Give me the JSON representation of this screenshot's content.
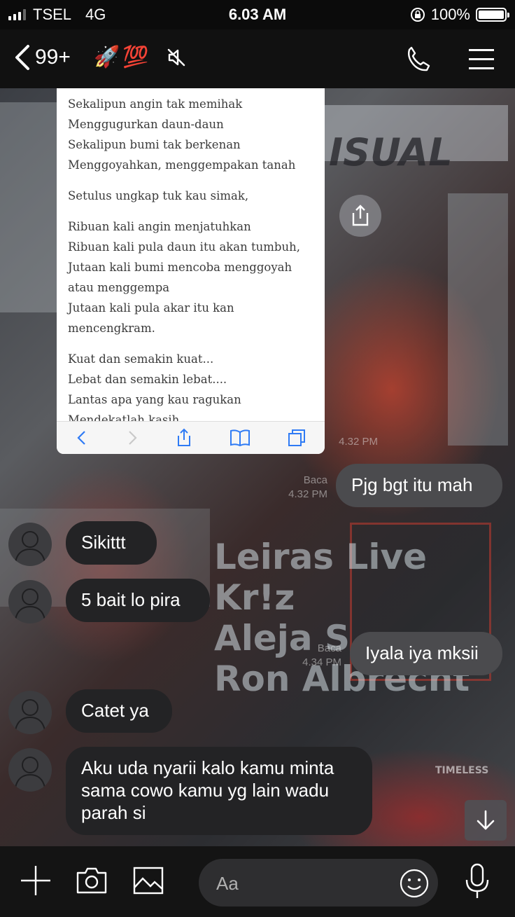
{
  "status": {
    "carrier": "TSEL",
    "network": "4G",
    "time": "6.03 AM",
    "battery": "100%"
  },
  "header": {
    "unread_count": "99+",
    "emojis": "🚀💯"
  },
  "article": {
    "stanza1": [
      "Sekalipun angin tak memihak",
      "Menggugurkan daun-daun",
      "Sekalipun bumi tak berkenan",
      "Menggoyahkan, menggempakan tanah"
    ],
    "stanza2": [
      "Setulus ungkap tuk kau simak,"
    ],
    "stanza3": [
      "Ribuan kali angin menjatuhkan",
      "Ribuan kali pula daun itu akan tumbuh,",
      "Jutaan kali bumi mencoba menggoyah atau menggempa",
      "Jutaan kali pula akar itu kan mencengkram."
    ],
    "stanza4": [
      "Kuat dan semakin kuat...",
      "Lebat dan semakin lebat....",
      "Lantas apa yang kau ragukan",
      "Mendekatlah kasih.."
    ]
  },
  "messages": [
    {
      "side": "out",
      "text": "Pjg bgt itu mah",
      "read": "Baca",
      "time": "4.32 PM"
    },
    {
      "side": "in",
      "text": "Sikittt"
    },
    {
      "side": "in",
      "text": "5 bait lo pira"
    },
    {
      "side": "out",
      "text": "Iyala iya mksii",
      "read": "Baca",
      "time": "4.34 PM"
    },
    {
      "side": "in",
      "text": "Catet ya"
    },
    {
      "side": "in",
      "text": "Aku uda nyarii kalo kamu minta sama cowo kamu yg lain wadu parah si"
    }
  ],
  "earlier_time": "4.32 PM",
  "composer": {
    "placeholder": "Aa"
  },
  "icons": [
    "back-chevron-icon",
    "mute-icon",
    "phone-icon",
    "menu-icon",
    "share-icon",
    "plus-icon",
    "camera-icon",
    "image-icon",
    "emoji-icon",
    "microphone-icon",
    "arrow-down-icon"
  ]
}
